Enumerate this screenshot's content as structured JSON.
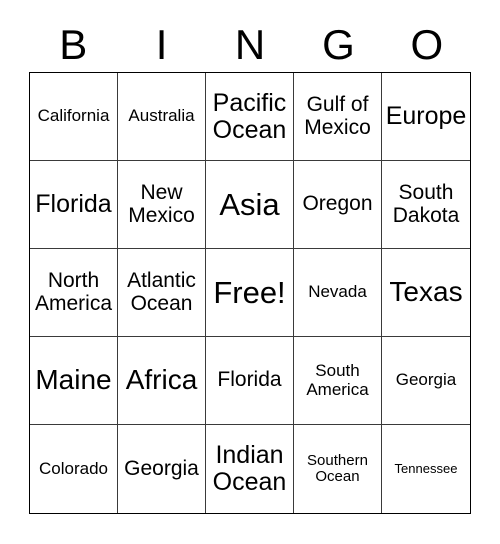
{
  "card": {
    "title_letters": [
      "B",
      "I",
      "N",
      "G",
      "O"
    ],
    "free_space_label": "Free!",
    "colors": {
      "background": "#ffffff",
      "text": "#000000",
      "border": "#000000",
      "gridline": "#3a3a3a"
    },
    "rows": [
      [
        {
          "label": "California",
          "size": "fs-sm"
        },
        {
          "label": "Australia",
          "size": "fs-sm"
        },
        {
          "label": "Pacific Ocean",
          "size": "fs-lg"
        },
        {
          "label": "Gulf of Mexico",
          "size": "fs-md"
        },
        {
          "label": "Europe",
          "size": "fs-lg"
        }
      ],
      [
        {
          "label": "Florida",
          "size": "fs-lg"
        },
        {
          "label": "New Mexico",
          "size": "fs-md"
        },
        {
          "label": "Asia",
          "size": "fs-xxl"
        },
        {
          "label": "Oregon",
          "size": "fs-md"
        },
        {
          "label": "South Dakota",
          "size": "fs-md"
        }
      ],
      [
        {
          "label": "North America",
          "size": "fs-md"
        },
        {
          "label": "Atlantic Ocean",
          "size": "fs-md"
        },
        {
          "label": "Free!",
          "size": "fs-xxl"
        },
        {
          "label": "Nevada",
          "size": "fs-sm"
        },
        {
          "label": "Texas",
          "size": "fs-xl"
        }
      ],
      [
        {
          "label": "Maine",
          "size": "fs-xl"
        },
        {
          "label": "Africa",
          "size": "fs-xl"
        },
        {
          "label": "Florida",
          "size": "fs-md"
        },
        {
          "label": "South America",
          "size": "fs-sm"
        },
        {
          "label": "Georgia",
          "size": "fs-sm"
        }
      ],
      [
        {
          "label": "Colorado",
          "size": "fs-sm"
        },
        {
          "label": "Georgia",
          "size": "fs-md"
        },
        {
          "label": "Indian Ocean",
          "size": "fs-lg"
        },
        {
          "label": "Southern Ocean",
          "size": "fs-xs"
        },
        {
          "label": "Tennessee",
          "size": "fs-xxs"
        }
      ]
    ]
  }
}
